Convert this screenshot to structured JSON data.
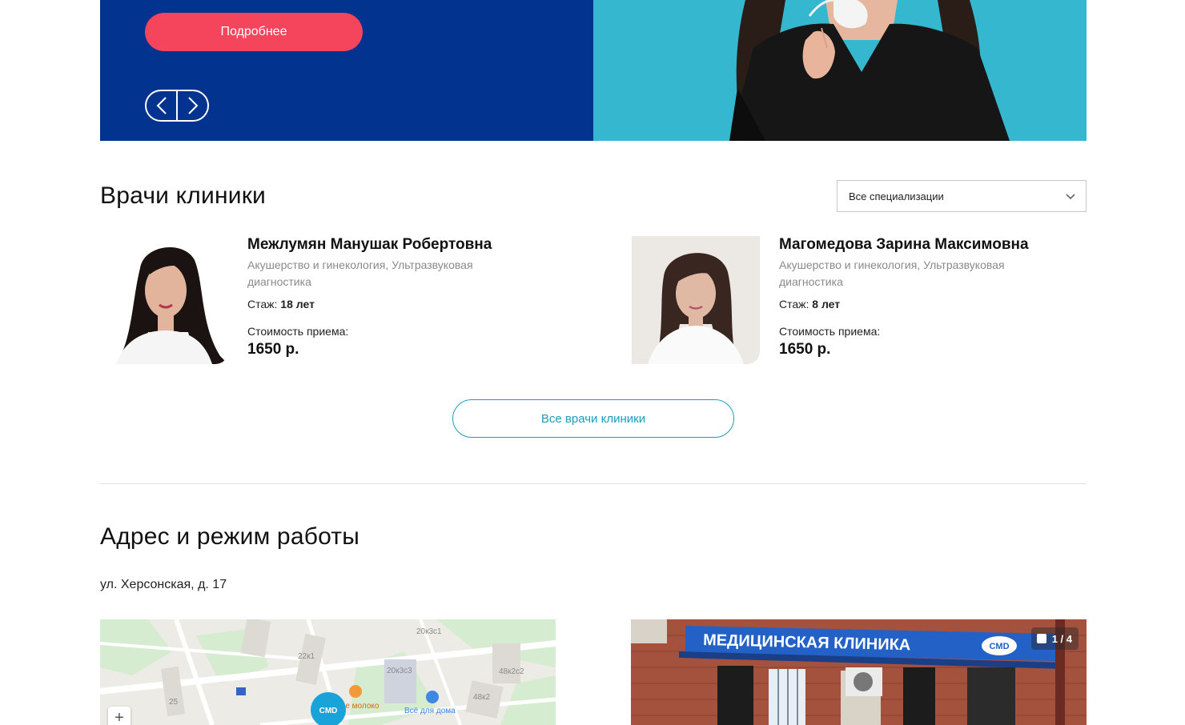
{
  "hero": {
    "button_label": "Подробнее",
    "colors": {
      "panel": "#02338f",
      "button": "#f5455c",
      "photo_bg": "#35b8cf"
    },
    "icons": [
      "arrow-left-icon",
      "arrow-right-icon"
    ]
  },
  "doctors": {
    "title": "Врачи клиники",
    "filter": {
      "selected": "Все специализации"
    },
    "list": [
      {
        "name": "Межлумян Манушак Робертовна",
        "specialty": "Акушерство и гинекология, Ультразвуковая диагностика",
        "experience_label": "Стаж:",
        "experience_value": "18 лет",
        "price_label": "Стоимость приема:",
        "price": "1650 р."
      },
      {
        "name": "Магомедова Зарина Максимовна",
        "specialty": "Акушерство и гинекология, Ультразвуковая диагностика",
        "experience_label": "Стаж:",
        "experience_value": "8 лет",
        "price_label": "Стоимость приема:",
        "price": "1650 р."
      }
    ],
    "all_button": "Все врачи клиники",
    "accent_color": "#1d9cb8"
  },
  "address": {
    "title": "Адрес и режим работы",
    "street": "ул. Херсонская, д. 17",
    "map": {
      "labels": [
        "20к3с1",
        "22к1",
        "20к3с3",
        "48к2с2",
        "48к2",
        "25",
        "...е молоко",
        "Всё для дома"
      ],
      "marker_text": "CMD",
      "zoom_in": "+"
    },
    "photo": {
      "counter": "1 / 4",
      "sign_text": "МЕДИЦИНСКАЯ КЛИНИКА",
      "sign_logo": "CMD"
    }
  }
}
